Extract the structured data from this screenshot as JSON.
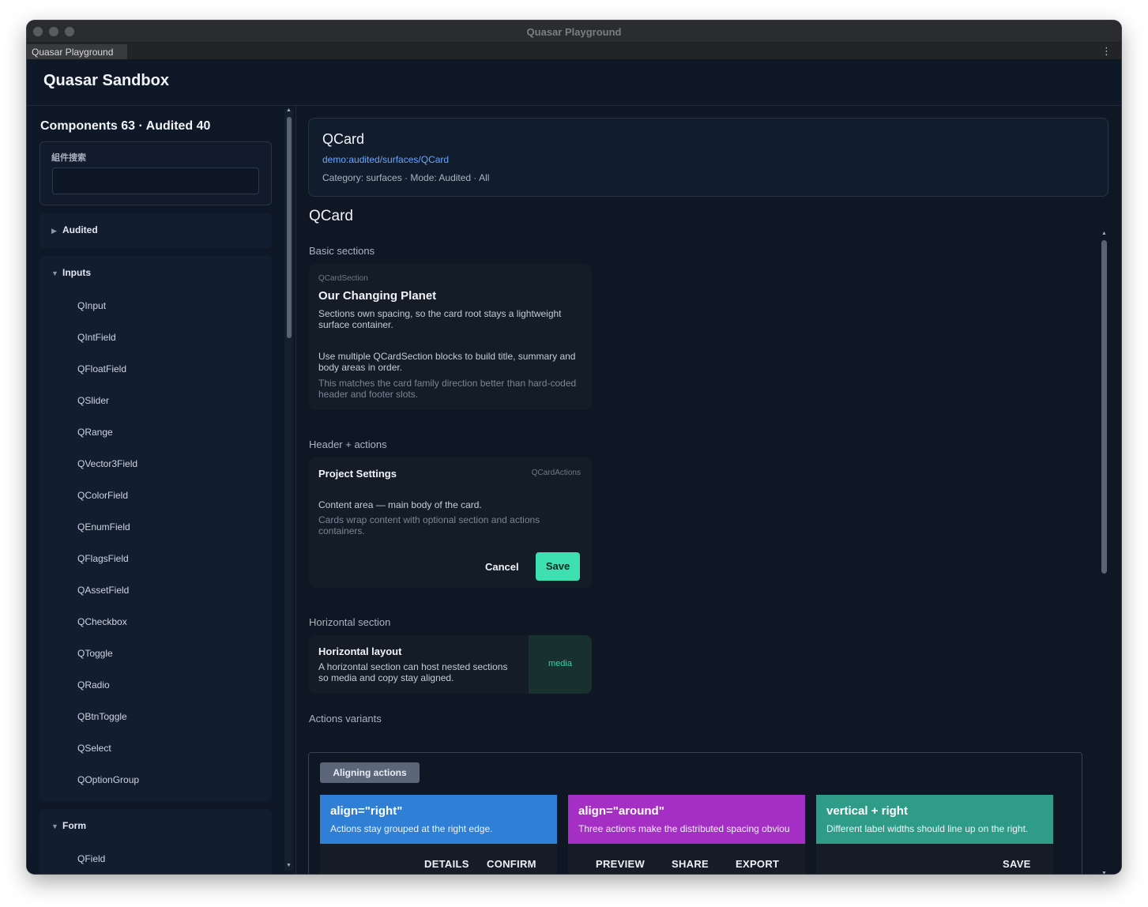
{
  "window": {
    "title": "Quasar Playground",
    "tab_label": "Quasar Playground",
    "menu_icon": "kebab-menu-icon"
  },
  "app": {
    "title": "Quasar Sandbox"
  },
  "sidebar": {
    "heading": "Components 63 · Audited 40",
    "search": {
      "label": "組件搜索",
      "value": "",
      "placeholder": ""
    },
    "groups": [
      {
        "label": "Audited",
        "expanded": false,
        "items": []
      },
      {
        "label": "Inputs",
        "expanded": true,
        "items": [
          "QInput",
          "QIntField",
          "QFloatField",
          "QSlider",
          "QRange",
          "QVector3Field",
          "QColorField",
          "QEnumField",
          "QFlagsField",
          "QAssetField",
          "QCheckbox",
          "QToggle",
          "QRadio",
          "QBtnToggle",
          "QSelect",
          "QOptionGroup"
        ]
      },
      {
        "label": "Form",
        "expanded": true,
        "items": [
          "QField"
        ]
      }
    ]
  },
  "component": {
    "name": "QCard",
    "path": "demo:audited/surfaces/QCard",
    "meta": "Category: surfaces · Mode: Audited · All"
  },
  "doc": {
    "title": "QCard",
    "basic": {
      "label": "Basic sections",
      "tag": "QCardSection",
      "title": "Our Changing Planet",
      "text1": "Sections own spacing, so the card root stays a lightweight surface container.",
      "text2": "Use multiple QCardSection blocks to build title, summary and body areas in order.",
      "text3": "This matches the card family direction better than hard-coded header and footer slots."
    },
    "header_actions": {
      "label": "Header + actions",
      "title": "Project Settings",
      "tag": "QCardActions",
      "text1": "Content area — main body of the card.",
      "text2": "Cards wrap content with optional section and actions containers.",
      "cancel": "Cancel",
      "save": "Save",
      "save_color": "#3ee0b2"
    },
    "horizontal": {
      "label": "Horizontal section",
      "title": "Horizontal layout",
      "text": "A horizontal section can host nested sections so media and copy stay aligned.",
      "media": "media"
    },
    "variants": {
      "label": "Actions variants",
      "chip": "Aligning actions",
      "cards": [
        {
          "title": "align=\"right\"",
          "subtitle": "Actions stay grouped at the right edge.",
          "color": "#2f7fd6",
          "actions": [
            "DETAILS",
            "CONFIRM"
          ]
        },
        {
          "title": "align=\"around\"",
          "subtitle": "Three actions make the distributed spacing obviou",
          "color": "#a52ec5",
          "actions": [
            "PREVIEW",
            "SHARE",
            "EXPORT"
          ]
        },
        {
          "title": "vertical + right",
          "subtitle": "Different label widths should line up on the right.",
          "color": "#2f9c88",
          "actions": [
            "SAVE"
          ]
        }
      ]
    }
  }
}
